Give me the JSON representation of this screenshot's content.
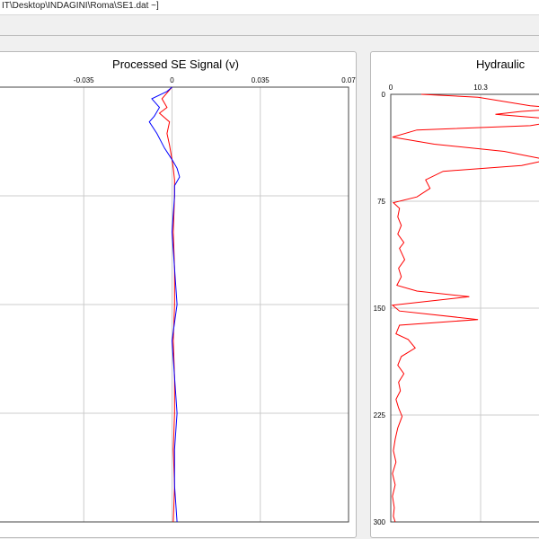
{
  "window": {
    "title": "IT\\Desktop\\INDAGINI\\Roma\\SE1.dat ~]"
  },
  "left_panel": {
    "title": "Processed SE Signal (v)",
    "x_ticks": [
      "-0.035",
      "0",
      "0.035",
      "0.07"
    ],
    "colors": {
      "series_a": "#ff0000",
      "series_b": "#0000ff",
      "grid": "#cccccc"
    }
  },
  "right_panel": {
    "title": "Hydraulic",
    "x_ticks": [
      "0",
      "10.3"
    ],
    "y_ticks": [
      "0",
      "75",
      "150",
      "225",
      "300"
    ],
    "colors": {
      "series": "#ff0000",
      "grid": "#cccccc"
    }
  },
  "chart_data": [
    {
      "type": "line",
      "title": "Processed SE Signal (v)",
      "xlim": [
        -0.07,
        0.07
      ],
      "x_ticks": [
        -0.035,
        0,
        0.035,
        0.07
      ],
      "ylim": [
        0,
        300
      ],
      "grid": true,
      "series": [
        {
          "color": "#ff0000",
          "points": [
            [
              0.0,
              0
            ],
            [
              -0.001,
              2
            ],
            [
              -0.004,
              8
            ],
            [
              -0.002,
              14
            ],
            [
              -0.005,
              18
            ],
            [
              -0.001,
              24
            ],
            [
              -0.002,
              32
            ],
            [
              -0.001,
              40
            ],
            [
              0.0,
              50
            ],
            [
              0.0005,
              56
            ],
            [
              0.001,
              64
            ],
            [
              0.001,
              75
            ],
            [
              0.0005,
              100
            ],
            [
              0.001,
              125
            ],
            [
              0.001,
              150
            ],
            [
              0.0005,
              175
            ],
            [
              0.001,
              200
            ],
            [
              0.001,
              225
            ],
            [
              0.0005,
              250
            ],
            [
              0.001,
              275
            ],
            [
              0.0005,
              300
            ]
          ]
        },
        {
          "color": "#0000ff",
          "points": [
            [
              0.0,
              0
            ],
            [
              -0.002,
              3
            ],
            [
              -0.008,
              8
            ],
            [
              -0.005,
              14
            ],
            [
              -0.007,
              20
            ],
            [
              -0.009,
              24
            ],
            [
              -0.006,
              32
            ],
            [
              -0.003,
              42
            ],
            [
              0.0,
              50
            ],
            [
              0.002,
              56
            ],
            [
              0.003,
              62
            ],
            [
              0.001,
              68
            ],
            [
              0.001,
              75
            ],
            [
              0.0,
              100
            ],
            [
              0.001,
              125
            ],
            [
              0.002,
              150
            ],
            [
              0.0,
              175
            ],
            [
              0.001,
              200
            ],
            [
              0.002,
              225
            ],
            [
              0.001,
              250
            ],
            [
              0.001,
              275
            ],
            [
              0.002,
              300
            ]
          ]
        }
      ]
    },
    {
      "type": "line",
      "title": "Hydraulic",
      "xlim": [
        0,
        20.6
      ],
      "x_ticks": [
        0,
        10.3
      ],
      "ylim": [
        0,
        300
      ],
      "y_ticks": [
        0,
        75,
        150,
        225,
        300
      ],
      "grid": true,
      "series": [
        {
          "color": "#ff0000",
          "points": [
            [
              3.5,
              0
            ],
            [
              10,
              2
            ],
            [
              16,
              8
            ],
            [
              20,
              10
            ],
            [
              15,
              12
            ],
            [
              12,
              14
            ],
            [
              20,
              18
            ],
            [
              16,
              22
            ],
            [
              3,
              25
            ],
            [
              0.2,
              30
            ],
            [
              5,
              35
            ],
            [
              13,
              40
            ],
            [
              18,
              46
            ],
            [
              15,
              50
            ],
            [
              6,
              54
            ],
            [
              4,
              60
            ],
            [
              4.5,
              66
            ],
            [
              3,
              72
            ],
            [
              0.3,
              76
            ],
            [
              1,
              80
            ],
            [
              0.8,
              86
            ],
            [
              1.2,
              92
            ],
            [
              0.8,
              98
            ],
            [
              1.5,
              104
            ],
            [
              1,
              108
            ],
            [
              1.6,
              116
            ],
            [
              0.9,
              122
            ],
            [
              1.2,
              128
            ],
            [
              0.7,
              134
            ],
            [
              3,
              138
            ],
            [
              9,
              142
            ],
            [
              0.2,
              148
            ],
            [
              1,
              152
            ],
            [
              10,
              158
            ],
            [
              1,
              162
            ],
            [
              0.6,
              168
            ],
            [
              2,
              172
            ],
            [
              2.8,
              178
            ],
            [
              1.2,
              184
            ],
            [
              0.8,
              190
            ],
            [
              1.5,
              196
            ],
            [
              0.9,
              202
            ],
            [
              1.1,
              208
            ],
            [
              0.6,
              214
            ],
            [
              0.9,
              220
            ],
            [
              1.3,
              226
            ],
            [
              0.8,
              234
            ],
            [
              0.5,
              242
            ],
            [
              0.3,
              250
            ],
            [
              0.6,
              258
            ],
            [
              0.2,
              266
            ],
            [
              0.5,
              274
            ],
            [
              0.2,
              282
            ],
            [
              0.4,
              290
            ],
            [
              0.3,
              296
            ],
            [
              0.5,
              300
            ]
          ]
        }
      ]
    }
  ]
}
